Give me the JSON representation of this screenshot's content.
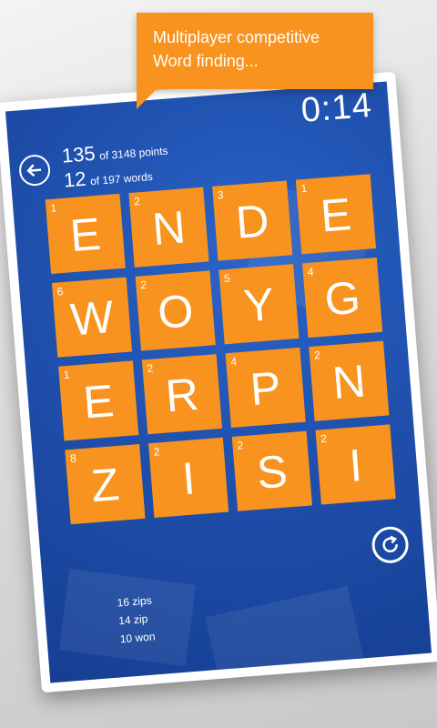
{
  "callout": {
    "line1": "Multiplayer competitive",
    "line2": "Word finding..."
  },
  "timer": "0:14",
  "score": {
    "points": "135",
    "points_suffix": "of 3148 points",
    "words": "12",
    "words_suffix": "of 197 words"
  },
  "tiles": [
    {
      "letter": "E",
      "points": "1"
    },
    {
      "letter": "N",
      "points": "2"
    },
    {
      "letter": "D",
      "points": "3"
    },
    {
      "letter": "E",
      "points": "1"
    },
    {
      "letter": "W",
      "points": "6"
    },
    {
      "letter": "O",
      "points": "2"
    },
    {
      "letter": "Y",
      "points": "5"
    },
    {
      "letter": "G",
      "points": "4"
    },
    {
      "letter": "E",
      "points": "1"
    },
    {
      "letter": "R",
      "points": "2"
    },
    {
      "letter": "P",
      "points": "4"
    },
    {
      "letter": "N",
      "points": "2"
    },
    {
      "letter": "Z",
      "points": "8"
    },
    {
      "letter": "I",
      "points": "2"
    },
    {
      "letter": "S",
      "points": "2"
    },
    {
      "letter": "I",
      "points": "2"
    }
  ],
  "found_words": [
    {
      "score": "16",
      "word": "zips"
    },
    {
      "score": "14",
      "word": "zip"
    },
    {
      "score": "10",
      "word": "won"
    }
  ],
  "colors": {
    "tile": "#f7931e",
    "board": "#1f50ad",
    "text": "#ffffff"
  },
  "icons": {
    "back": "back-arrow-icon",
    "refresh": "refresh-icon"
  }
}
